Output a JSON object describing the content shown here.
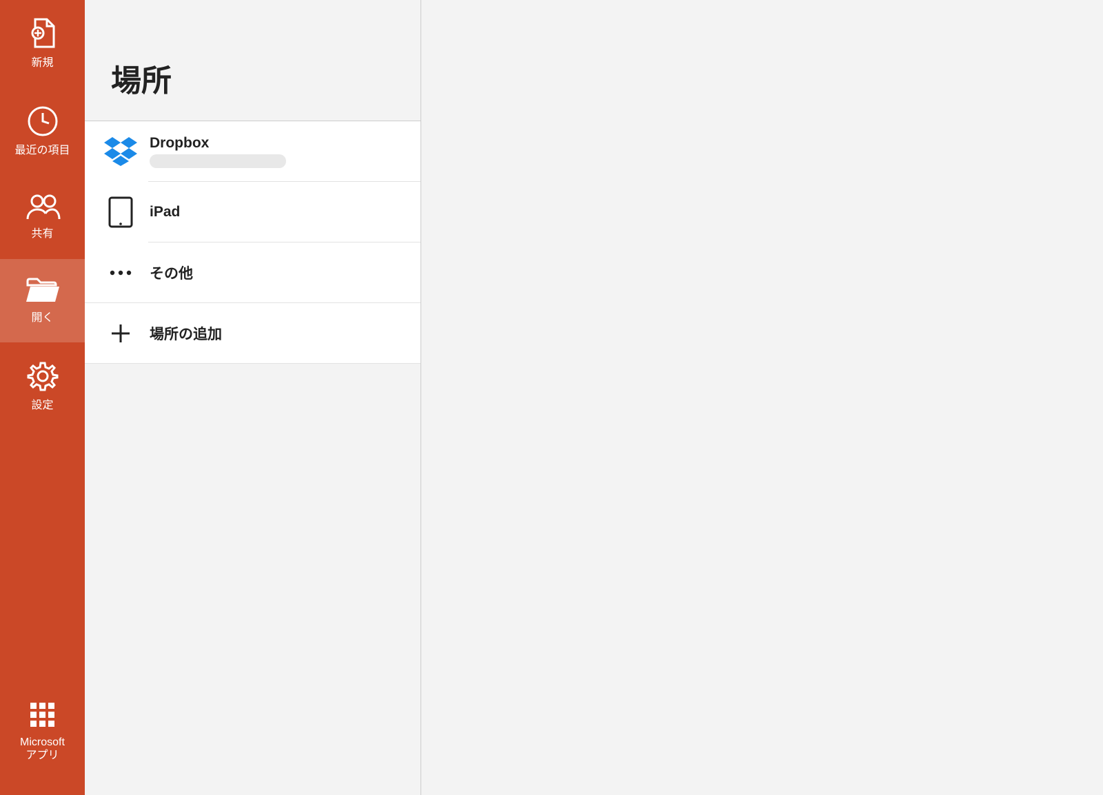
{
  "sidebar": {
    "items": [
      {
        "id": "new",
        "label": "新規"
      },
      {
        "id": "recent",
        "label": "最近の項目"
      },
      {
        "id": "shared",
        "label": "共有"
      },
      {
        "id": "open",
        "label": "開く"
      },
      {
        "id": "settings",
        "label": "設定"
      }
    ],
    "bottom": {
      "label": "Microsoft\nアプリ"
    }
  },
  "panel": {
    "title": "場所",
    "places": [
      {
        "id": "dropbox",
        "label": "Dropbox"
      },
      {
        "id": "ipad",
        "label": "iPad"
      },
      {
        "id": "more",
        "label": "その他"
      },
      {
        "id": "add",
        "label": "場所の追加"
      }
    ]
  }
}
